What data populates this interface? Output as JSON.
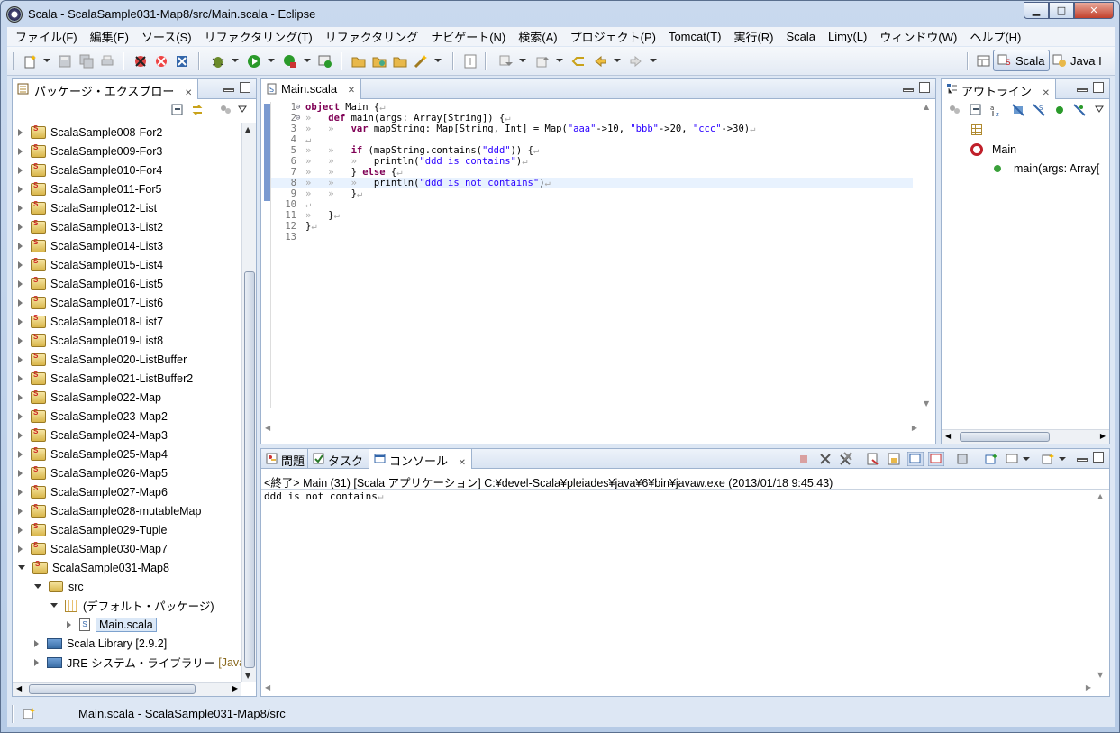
{
  "window": {
    "title": "Scala - ScalaSample031-Map8/src/Main.scala - Eclipse"
  },
  "menu": [
    "ファイル(F)",
    "編集(E)",
    "ソース(S)",
    "リファクタリング(T)",
    "リファクタリング",
    "ナビゲート(N)",
    "検索(A)",
    "プロジェクト(P)",
    "Tomcat(T)",
    "実行(R)",
    "Scala",
    "Limy(L)",
    "ウィンドウ(W)",
    "ヘルプ(H)"
  ],
  "perspectives": {
    "scala": "Scala",
    "java": "Java I"
  },
  "package_explorer": {
    "title": "パッケージ・エクスプロー",
    "projects": [
      "ScalaSample008-For2",
      "ScalaSample009-For3",
      "ScalaSample010-For4",
      "ScalaSample011-For5",
      "ScalaSample012-List",
      "ScalaSample013-List2",
      "ScalaSample014-List3",
      "ScalaSample015-List4",
      "ScalaSample016-List5",
      "ScalaSample017-List6",
      "ScalaSample018-List7",
      "ScalaSample019-List8",
      "ScalaSample020-ListBuffer",
      "ScalaSample021-ListBuffer2",
      "ScalaSample022-Map",
      "ScalaSample023-Map2",
      "ScalaSample024-Map3",
      "ScalaSample025-Map4",
      "ScalaSample026-Map5",
      "ScalaSample027-Map6",
      "ScalaSample028-mutableMap",
      "ScalaSample029-Tuple",
      "ScalaSample030-Map7",
      "ScalaSample031-Map8"
    ],
    "src": "src",
    "default_package": "(デフォルト・パッケージ)",
    "file": "Main.scala",
    "scala_library": "Scala Library [2.9.2]",
    "jre": "JRE システム・ライブラリー",
    "jre_suffix": "[Java"
  },
  "editor": {
    "tab": "Main.scala",
    "lines": [
      "1",
      "2",
      "3",
      "4",
      "5",
      "6",
      "7",
      "8",
      "9",
      "10",
      "11",
      "12",
      "13"
    ]
  },
  "outline": {
    "title": "アウトライン",
    "main": "Main",
    "method": "main(args: Array["
  },
  "bottom": {
    "tab_problems": "問題",
    "tab_tasks": "タスク",
    "tab_console": "コンソール",
    "console_header": "<終了> Main (31) [Scala アプリケーション] C:¥devel-Scala¥pleiades¥java¥6¥bin¥javaw.exe (2013/01/18 9:45:43)",
    "console_output": "ddd is not contains"
  },
  "status": {
    "text": "Main.scala - ScalaSample031-Map8/src"
  }
}
